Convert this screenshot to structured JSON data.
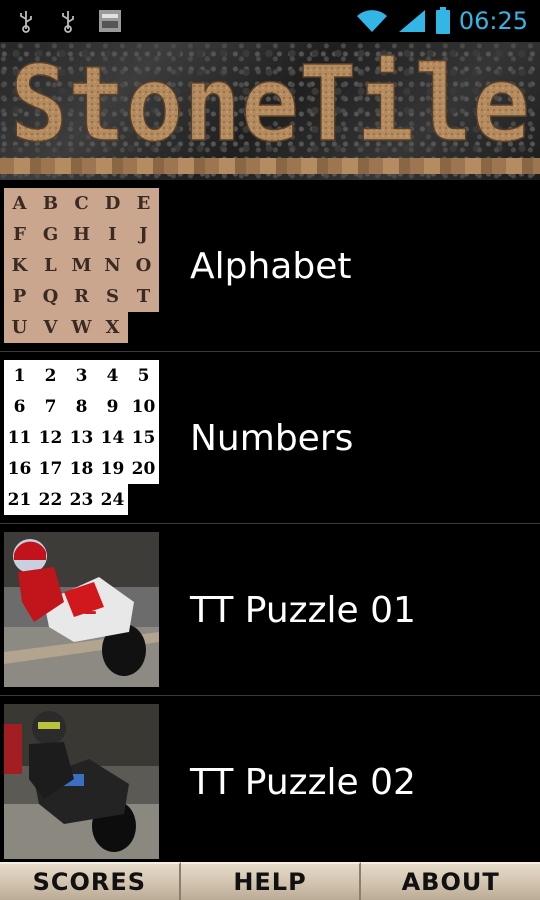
{
  "status_bar": {
    "time": "06:25",
    "icons": [
      "usb-icon",
      "usb-icon",
      "app-notification-icon",
      "wifi-icon",
      "signal-icon",
      "battery-icon"
    ],
    "accent_color": "#33b5e5"
  },
  "header": {
    "logo_text": "StoneTile"
  },
  "puzzles": [
    {
      "label": "Alphabet",
      "thumb": "letters"
    },
    {
      "label": "Numbers",
      "thumb": "numbers"
    },
    {
      "label": "TT Puzzle 01",
      "thumb": "photo-rider-red"
    },
    {
      "label": "TT Puzzle 02",
      "thumb": "photo-rider-black"
    }
  ],
  "alphabet_tiles": [
    "A",
    "B",
    "C",
    "D",
    "E",
    "F",
    "G",
    "H",
    "I",
    "J",
    "K",
    "L",
    "M",
    "N",
    "O",
    "P",
    "Q",
    "R",
    "S",
    "T",
    "U",
    "V",
    "W",
    "X",
    ""
  ],
  "number_tiles": [
    "1",
    "2",
    "3",
    "4",
    "5",
    "6",
    "7",
    "8",
    "9",
    "10",
    "11",
    "12",
    "13",
    "14",
    "15",
    "16",
    "17",
    "18",
    "19",
    "20",
    "21",
    "22",
    "23",
    "24",
    ""
  ],
  "buttons": {
    "scores": "SCORES",
    "help": "HELP",
    "about": "ABOUT"
  }
}
